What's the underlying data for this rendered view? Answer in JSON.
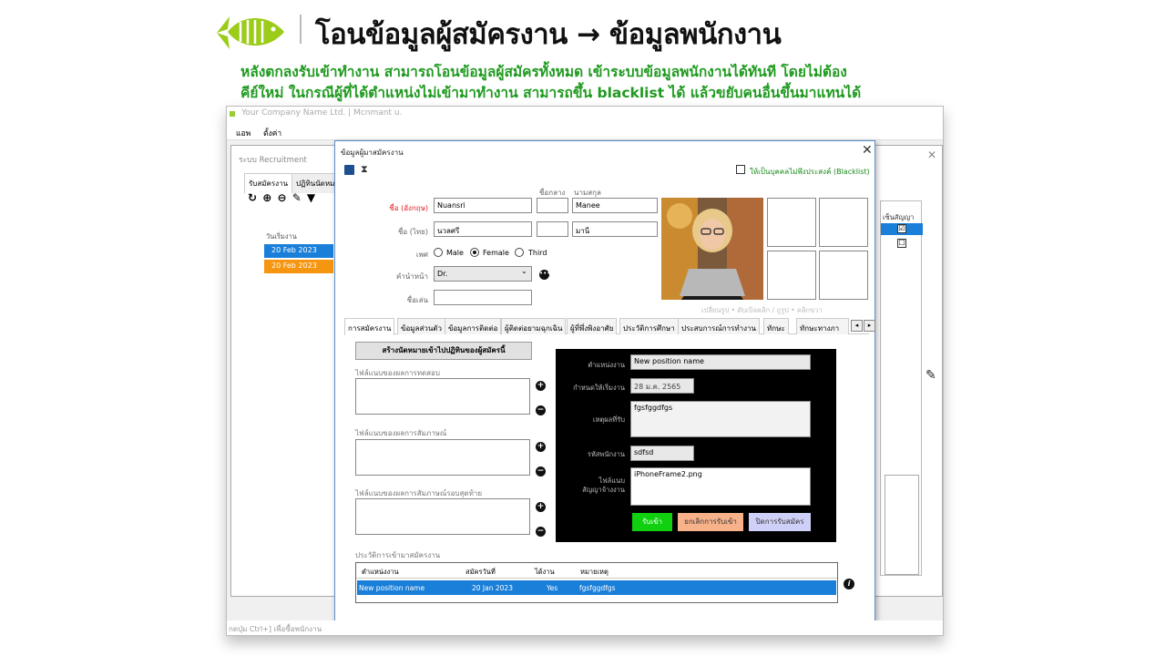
{
  "slide": {
    "title": "โอนข้อมูลผู้สมัครงาน → ข้อมูลพนักงาน",
    "desc_line1": "หลังตกลงรับเข้าทำงาน  สามารถโอนข้อมูลผู้สมัครทั้งหมด  เข้าระบบข้อมูลพนักงานได้ทันที  โดยไม่ต้อง",
    "desc_line2": "คีย์ใหม่ ในกรณีผู้ที่ได้ตำแหน่งไม่เข้ามาทำงาน สามารถขึ้น blacklist ได้ แล้วขยับคนอื่นขึ้นมาแทนได้"
  },
  "app": {
    "window_title": "Your Company Name Ltd. | Mcnmant u.",
    "menu": [
      "แอพ",
      "ตั้งค่า"
    ],
    "status_text": "กดปุ่ม Ctrl+] เพื่อซื้อพนักงาน"
  },
  "bg_window": {
    "title": "ระบบ Recruitment",
    "tabs": [
      "รับสมัครงาน",
      "ปฏิทินนัดหมาย"
    ],
    "toolbar": "↻ ⊕ ⊖ ✎ ▼",
    "col_header": "วันเริ่มงาน",
    "rows": [
      "20 Feb 2023",
      "20 Feb 2023"
    ],
    "right_header": "เซ็นสัญญา",
    "right_checks": [
      "☑",
      "☐"
    ]
  },
  "dialog": {
    "title": "ข้อมูลผู้มาสมัครงาน",
    "blacklist_label": "ให้เป็นบุคคลไม่พึงประสงค์ (Blacklist)",
    "labels": {
      "middle": "ชื่อกลาง",
      "last": "นามสกุล",
      "name_en": "ชื่อ (อังกฤษ)",
      "name_th": "ชื่อ (ไทย)",
      "sex": "เพศ",
      "prefix": "คำนำหน้า",
      "nickname": "ชื่อเล่น"
    },
    "values": {
      "first_en": "Nuansri",
      "middle_en": "",
      "last_en": "Manee",
      "first_th": "นวลศรี",
      "middle_th": "",
      "last_th": "มานี",
      "prefix": "Dr.",
      "nickname": ""
    },
    "sex_options": [
      "Male",
      "Female",
      "Third"
    ],
    "sex_selected": "Female",
    "photo_hint": "เปลี่ยนรูป • ดับเบิลคลิก / ถูรูป • คลิกขวา",
    "tabs": [
      "การสมัครงาน",
      "ข้อมูลส่วนตัว",
      "ข้อมูลการติดต่อ",
      "ผู้ติดต่อยามฉุกเฉิน",
      "ผู้ที่พึ่งพิงอาศัย",
      "ประวัติการศึกษา",
      "ประสบการณ์การทำงาน",
      "ทักษะ",
      "ทักษะทางภา"
    ],
    "make_appointment": "สร้างนัดหมายเข้าไปปฏิทินของผู้สมัครนี้",
    "file_labels": [
      "ไฟล์แนบของผลการทดสอบ",
      "ไฟล์แนบของผลการสัมภาษณ์",
      "ไฟล์แนบของผลการสัมภาษณ์รอบสุดท้าย"
    ],
    "panel": {
      "labels": {
        "position": "ตำแหน่งงาน",
        "start": "กำหนดให้เริ่มงาน",
        "reason": "เหตุผลที่รับ",
        "emp_code": "รหัสพนักงาน",
        "file": "ไฟล์แนบ\nสัญญาจ้างงาน"
      },
      "position": "New position name",
      "start_date": "28 ม.ค. 2565",
      "reason": "fgsfggdfgs",
      "emp_code": "sdfsd",
      "file": "iPhoneFrame2.png",
      "buttons": {
        "accept": "รับเข้า",
        "cancel": "ยกเลิกการรับเข้า",
        "close": "ปิดการรับสมัคร"
      }
    },
    "history": {
      "label": "ประวัติการเข้ามาสมัครงาน",
      "headers": [
        "ตำแหน่งงาน",
        "สมัครวันที่",
        "ได้งาน",
        "หมายเหตุ"
      ],
      "rows": [
        [
          "New position name",
          "20 Jan 2023",
          "Yes",
          "fgsfggdfgs"
        ]
      ]
    }
  },
  "colors": {
    "accent_green": "#1f9a1f",
    "selected_blue": "#1a7fd9",
    "orange_row": "#f6950f",
    "accept_green": "#10d010"
  }
}
